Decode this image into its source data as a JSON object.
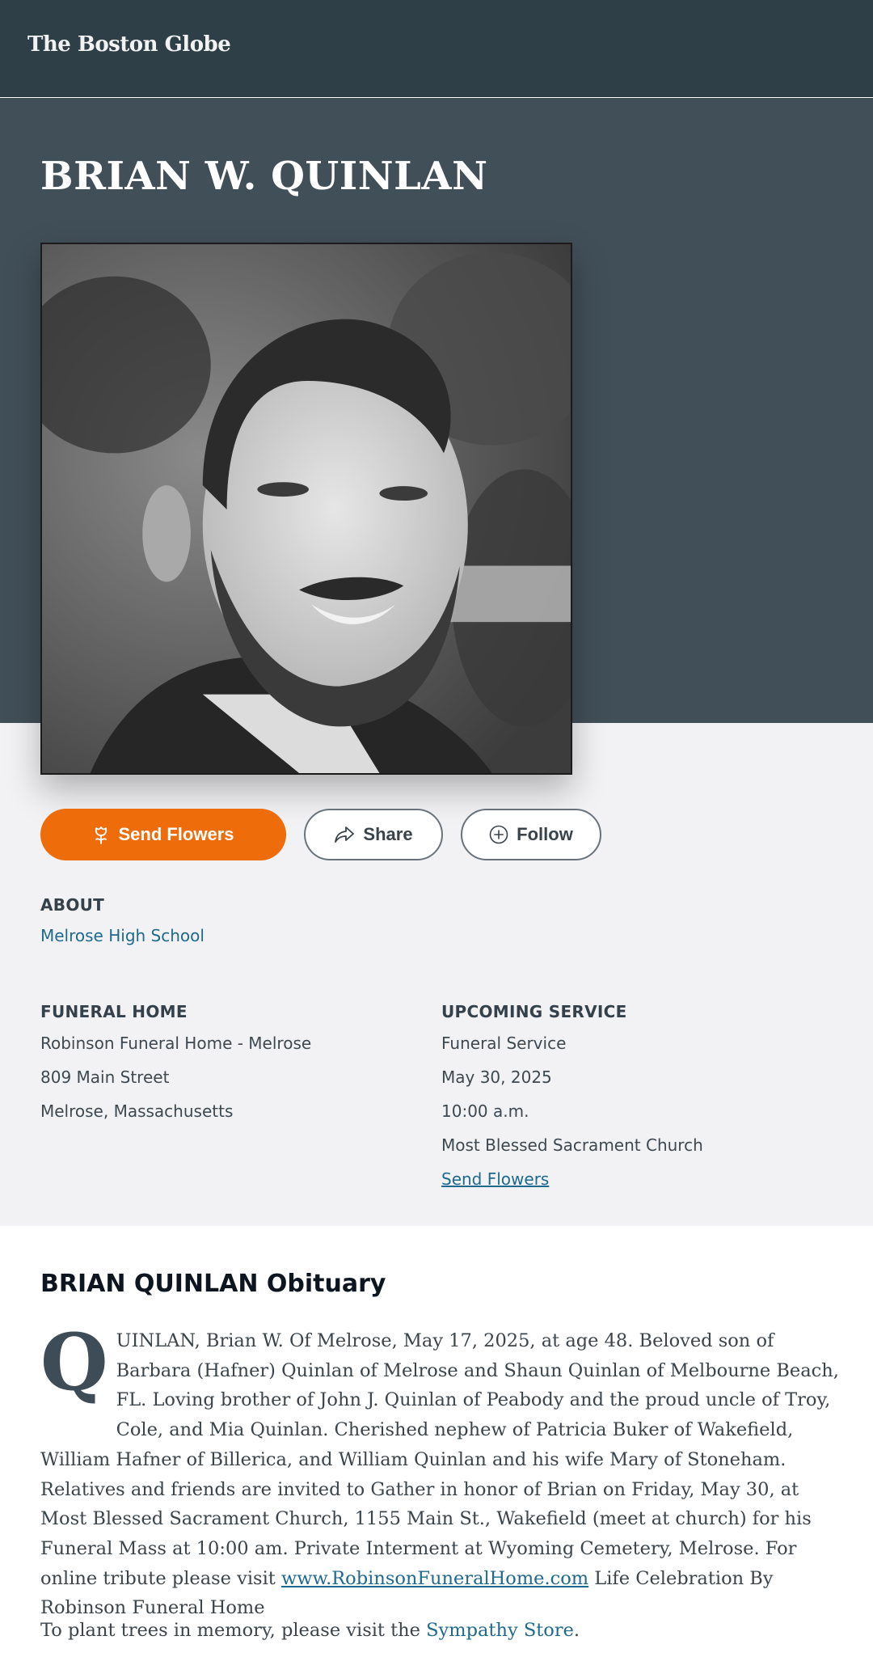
{
  "header": {
    "logo_text": "The Boston Globe"
  },
  "person": {
    "name": "BRIAN W. QUINLAN"
  },
  "actions": {
    "send_flowers": "Send Flowers",
    "share": "Share",
    "follow": "Follow"
  },
  "about": {
    "heading": "ABOUT",
    "school": "Melrose High School"
  },
  "funeral_home": {
    "heading": "FUNERAL HOME",
    "name": "Robinson Funeral Home - Melrose",
    "street": "809 Main Street",
    "city": "Melrose, Massachusetts"
  },
  "service": {
    "heading": "UPCOMING SERVICE",
    "type": "Funeral Service",
    "date": "May 30, 2025",
    "time": "10:00 a.m.",
    "location": "Most Blessed Sacrament Church",
    "flowers_link": "Send Flowers"
  },
  "obituary": {
    "title": "BRIAN QUINLAN Obituary",
    "drop_cap": "Q",
    "text_before_link": "UINLAN, Brian W. Of Melrose, May 17, 2025, at age 48. Beloved son of Barbara (Hafner) Quinlan of Melrose and Shaun Quinlan of Melbourne Beach, FL. Loving brother of John J. Quinlan of Peabody and the proud uncle of Troy, Cole, and Mia Quinlan. Cherished nephew of Patricia Buker of Wakefield, William Hafner of Billerica, and William Quinlan and his wife Mary of Stoneham. Relatives and friends are invited to Gather in honor of Brian on Friday, May 30, at Most Blessed Sacrament Church, 1155 Main St., Wakefield (meet at church) for his Funeral Mass at 10:00 am. Private Interment at Wyoming Cemetery, Melrose. For online tribute please visit ",
    "link_text": "www.RobinsonFuneralHome.com",
    "text_after_link": " Life Celebration By Robinson Funeral Home",
    "trees_text": "To plant trees in memory, please visit the ",
    "trees_link": "Sympathy Store",
    "trees_end": "."
  },
  "colors": {
    "header_bg": "#2f3f48",
    "hero_bg": "#414f58",
    "accent_orange": "#ef6c0a",
    "link_blue": "#1e6a8e"
  },
  "icons": [
    "flower-icon",
    "share-arrow-icon",
    "plus-circle-icon"
  ]
}
